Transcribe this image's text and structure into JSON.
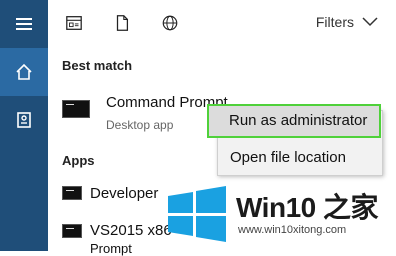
{
  "rail": {
    "items": [
      {
        "icon": "hamburger-menu-icon",
        "active": false
      },
      {
        "icon": "home-icon",
        "active": true
      },
      {
        "icon": "notebook-icon",
        "active": false
      }
    ]
  },
  "topbar": {
    "icons": [
      "document-web-icon",
      "document-icon",
      "globe-icon"
    ],
    "filters_label": "Filters",
    "filters_chevron": "chevron-down-icon"
  },
  "results": {
    "best_match_heading": "Best match",
    "best_match": {
      "title": "Command Prompt",
      "subtitle": "Desktop app",
      "icon": "command-prompt-icon"
    },
    "apps_heading": "Apps",
    "apps": [
      {
        "title": "Developer",
        "icon": "command-prompt-icon"
      },
      {
        "title": "VS2015 x86",
        "icon": "command-prompt-icon"
      },
      {
        "title": "Prompt",
        "icon": ""
      }
    ]
  },
  "context_menu": {
    "items": [
      "Run as administrator",
      "Open file location"
    ],
    "highlighted_index": 0
  },
  "watermark": {
    "title": "Win10 之家",
    "url": "www.win10xitong.com",
    "logo_color": "#1aa1e1"
  },
  "colors": {
    "rail": "#1f4e79",
    "rail_active": "#2b6aa3",
    "highlight_border": "#4fd13a"
  }
}
